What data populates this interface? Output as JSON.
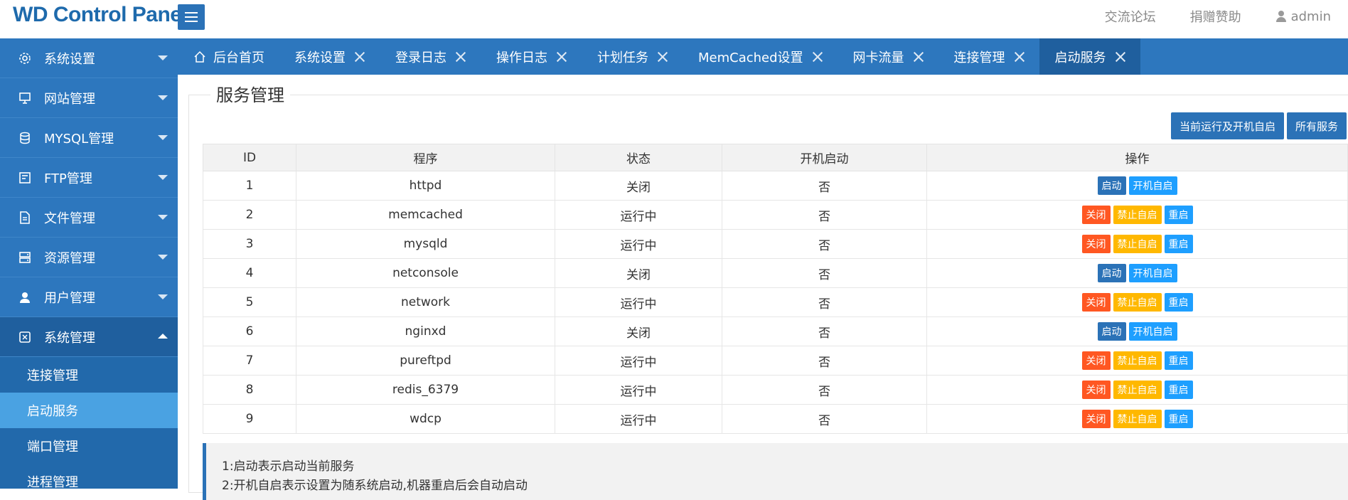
{
  "header": {
    "logo": "WD Control Panel",
    "links": [
      "交流论坛",
      "捐赠赞助"
    ],
    "user": "admin"
  },
  "sidebar": {
    "items": [
      {
        "label": "系统设置",
        "icon": "gear-icon"
      },
      {
        "label": "网站管理",
        "icon": "monitor-icon"
      },
      {
        "label": "MYSQL管理",
        "icon": "database-icon"
      },
      {
        "label": "FTP管理",
        "icon": "ftp-icon"
      },
      {
        "label": "文件管理",
        "icon": "file-icon"
      },
      {
        "label": "资源管理",
        "icon": "server-icon"
      },
      {
        "label": "用户管理",
        "icon": "user-icon"
      },
      {
        "label": "系统管理",
        "icon": "system-icon"
      }
    ],
    "subitems": [
      "连接管理",
      "启动服务",
      "端口管理",
      "进程管理"
    ]
  },
  "tabs": [
    "后台首页",
    "系统设置",
    "登录日志",
    "操作日志",
    "计划任务",
    "MemCached设置",
    "网卡流量",
    "连接管理",
    "启动服务"
  ],
  "main": {
    "title": "服务管理",
    "buttons": [
      "当前运行及开机自启",
      "所有服务"
    ],
    "columns": [
      "ID",
      "程序",
      "状态",
      "开机启动",
      "操作"
    ],
    "rows": [
      {
        "id": "1",
        "program": "httpd",
        "status": "关闭",
        "boot": "否",
        "ops": [
          "启动",
          "开机自启"
        ]
      },
      {
        "id": "2",
        "program": "memcached",
        "status": "运行中",
        "boot": "否",
        "ops": [
          "关闭",
          "禁止自启",
          "重启"
        ]
      },
      {
        "id": "3",
        "program": "mysqld",
        "status": "运行中",
        "boot": "否",
        "ops": [
          "关闭",
          "禁止自启",
          "重启"
        ]
      },
      {
        "id": "4",
        "program": "netconsole",
        "status": "关闭",
        "boot": "否",
        "ops": [
          "启动",
          "开机自启"
        ]
      },
      {
        "id": "5",
        "program": "network",
        "status": "运行中",
        "boot": "否",
        "ops": [
          "关闭",
          "禁止自启",
          "重启"
        ]
      },
      {
        "id": "6",
        "program": "nginxd",
        "status": "关闭",
        "boot": "否",
        "ops": [
          "启动",
          "开机自启"
        ]
      },
      {
        "id": "7",
        "program": "pureftpd",
        "status": "运行中",
        "boot": "否",
        "ops": [
          "关闭",
          "禁止自启",
          "重启"
        ]
      },
      {
        "id": "8",
        "program": "redis_6379",
        "status": "运行中",
        "boot": "否",
        "ops": [
          "关闭",
          "禁止自启",
          "重启"
        ]
      },
      {
        "id": "9",
        "program": "wdcp",
        "status": "运行中",
        "boot": "否",
        "ops": [
          "关闭",
          "禁止自启",
          "重启"
        ]
      }
    ],
    "notes": [
      "1:启动表示启动当前服务",
      "2:开机自启表示设置为随系统启动,机器重启后会自动启动"
    ]
  },
  "colors": {
    "brand": "#2d77be",
    "brand_dark": "#1f5f9e",
    "active_sub": "#4aa2e2",
    "btn_start": "#2b72b7",
    "btn_boot": "#1e9fff",
    "btn_close": "#ff5722",
    "btn_noboot": "#ffb800"
  }
}
